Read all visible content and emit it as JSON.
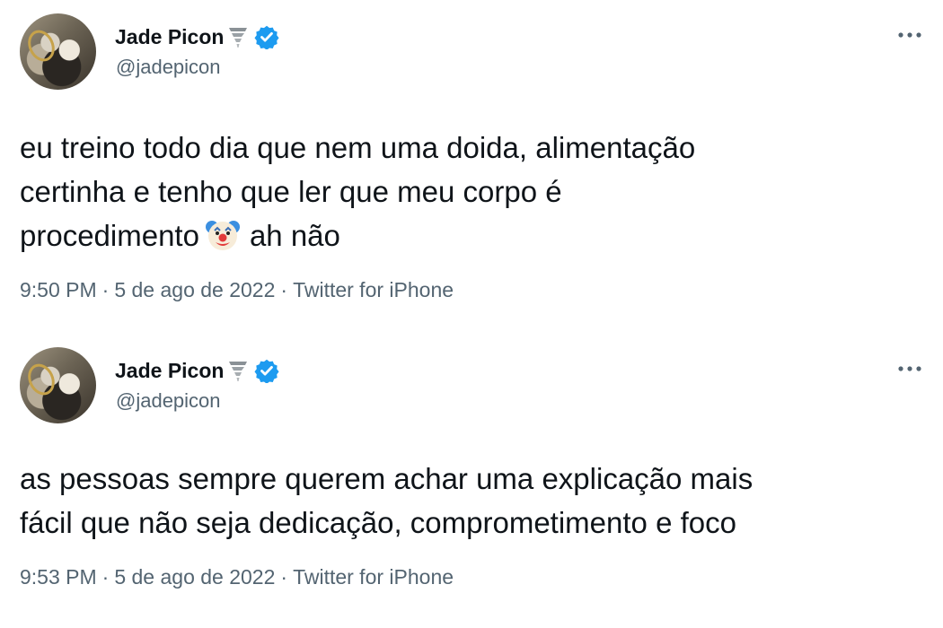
{
  "tweets": [
    {
      "author": {
        "name": "Jade Picon",
        "handle": "@jadepicon",
        "emoji_icon": "tornado-icon",
        "verified": true
      },
      "text_lines": [
        "eu treino todo dia que nem uma doida, alimentação",
        "certinha e tenho que ler que meu corpo é"
      ],
      "text_last_before_emoji": "procedimento",
      "emoji": "clown-face-icon",
      "text_last_after_emoji": "ah não",
      "time": "9:50 PM",
      "date": "5 de ago de 2022",
      "source": "Twitter for iPhone",
      "separator": "·"
    },
    {
      "author": {
        "name": "Jade Picon",
        "handle": "@jadepicon",
        "emoji_icon": "tornado-icon",
        "verified": true
      },
      "text_lines": [
        "as pessoas sempre querem achar uma explicação mais",
        "fácil que não seja dedicação, comprometimento e foco"
      ],
      "time": "9:53 PM",
      "date": "5 de ago de 2022",
      "source": "Twitter for iPhone",
      "separator": "·"
    }
  ],
  "colors": {
    "verified": "#1d9bf0",
    "text": "#0f1419",
    "secondary": "#536471"
  }
}
